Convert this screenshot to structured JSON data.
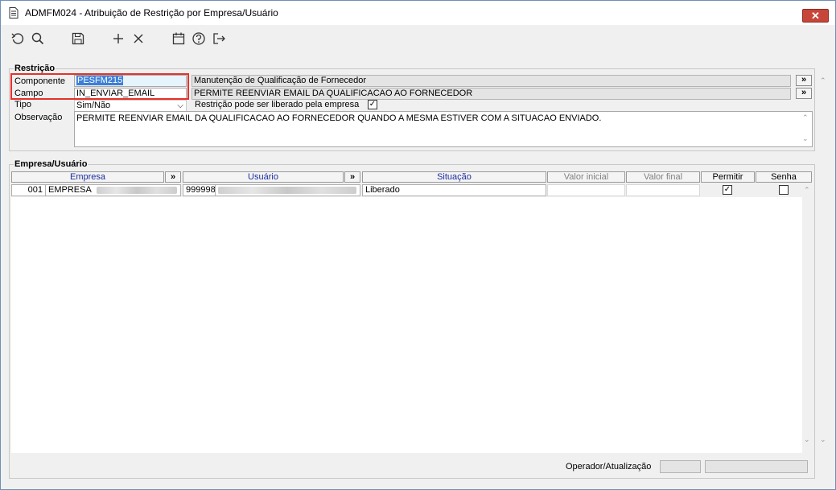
{
  "window": {
    "title": "ADMFM024 - Atribuição de Restrição por Empresa/Usuário",
    "close_label": "✕"
  },
  "toolbar": {
    "icons": [
      "undo-icon",
      "search-icon",
      "save-icon",
      "add-icon",
      "delete-icon",
      "calendar-icon",
      "help-icon",
      "exit-icon"
    ]
  },
  "restricao": {
    "group_label": "Restrição",
    "componente": {
      "label": "Componente",
      "code": "PESFM215",
      "description": "Manutenção de Qualificação de Fornecedor"
    },
    "campo": {
      "label": "Campo",
      "code": "IN_ENVIAR_EMAIL",
      "description": "PERMITE REENVIAR EMAIL DA QUALIFICACAO AO FORNECEDOR"
    },
    "tipo": {
      "label": "Tipo",
      "value": "Sim/Não"
    },
    "liberado": {
      "label": "Restrição pode ser liberado pela empresa",
      "checked": true
    },
    "observacao": {
      "label": "Observação",
      "value": "PERMITE REENVIAR EMAIL DA QUALIFICACAO AO FORNECEDOR QUANDO A MESMA ESTIVER COM A SITUACAO ENVIADO."
    },
    "more_label": "»"
  },
  "empresa_usuario": {
    "group_label": "Empresa/Usuário",
    "columns": {
      "empresa": "Empresa",
      "usuario": "Usuário",
      "situacao": "Situação",
      "valor_inicial": "Valor inicial",
      "valor_final": "Valor final",
      "permitir": "Permitir",
      "senha": "Senha",
      "more": "»"
    },
    "rows": [
      {
        "empresa_code": "001",
        "empresa_name": "EMPRESA",
        "usuario_code": "999998",
        "situacao": "Liberado",
        "valor_inicial": "",
        "valor_final": "",
        "permitir": true,
        "senha": false
      }
    ]
  },
  "footer": {
    "label": "Operador/Atualização"
  },
  "colors": {
    "highlight_border": "#e8312b",
    "selection": "#3d7fd6",
    "header_blue": "#1a2c9e"
  }
}
